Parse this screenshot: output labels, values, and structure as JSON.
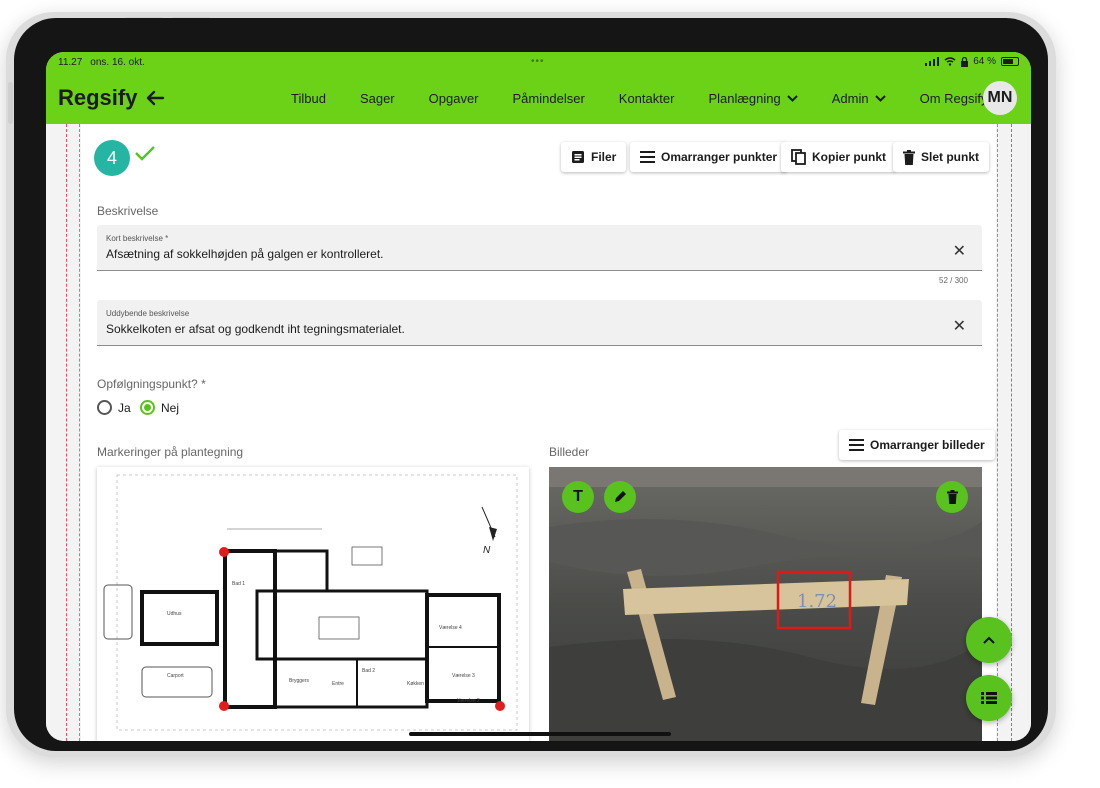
{
  "status_bar": {
    "time": "11.27",
    "date": "ons. 16. okt.",
    "battery": "64 %"
  },
  "app": {
    "brand": "Regsify"
  },
  "nav": {
    "items": [
      {
        "label": "Tilbud"
      },
      {
        "label": "Sager"
      },
      {
        "label": "Opgaver"
      },
      {
        "label": "Påmindelser"
      },
      {
        "label": "Kontakter"
      },
      {
        "label": "Planlægning",
        "dropdown": true
      },
      {
        "label": "Admin",
        "dropdown": true
      },
      {
        "label": "Om Regsify",
        "dropdown": true
      }
    ],
    "avatar": "MN"
  },
  "point": {
    "number": "4"
  },
  "toolbar": {
    "files": "Filer",
    "rearrange_points": "Omarranger punkter",
    "copy_point": "Kopier punkt",
    "delete_point": "Slet punkt"
  },
  "description": {
    "section_label": "Beskrivelse",
    "short_label": "Kort beskrivelse *",
    "short_value": "Afsætning af sokkelhøjden på galgen er kontrolleret.",
    "counter": "52 / 300",
    "long_label": "Uddybende beskrivelse",
    "long_value": "Sokkelkoten er afsat og godkendt iht tegningsmaterialet."
  },
  "followup": {
    "label": "Opfølgningspunkt? *",
    "yes": "Ja",
    "no": "Nej",
    "selected": "Nej"
  },
  "markings": {
    "label": "Markeringer på plantegning"
  },
  "images": {
    "label": "Billeder",
    "rearrange": "Omarranger billeder",
    "photo_text": "1.72"
  },
  "plan": {
    "north": "N",
    "rooms": [
      "Udhus",
      "Carport",
      "Bad 1",
      "Værelse 4",
      "Køkken",
      "Værelse 3",
      "Værelse 2",
      "Entre",
      "Bryggers",
      "Bad 2"
    ]
  },
  "colors": {
    "brand_green": "#6cd217",
    "step_teal": "#26b5a3",
    "button_green": "#59c21e"
  }
}
